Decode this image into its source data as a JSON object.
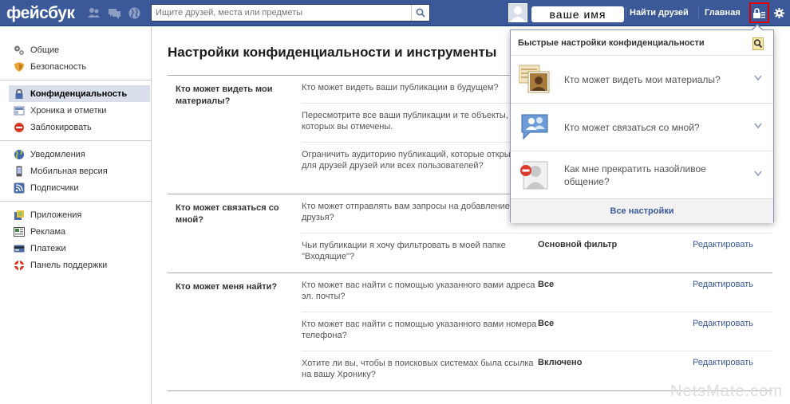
{
  "topbar": {
    "logo": "фейсбук",
    "search_placeholder": "Ищите друзей, места или предметы",
    "user_name": "ваше имя",
    "find_friends": "Найти друзей",
    "home": "Главная"
  },
  "sidebar": {
    "groups": [
      [
        {
          "label": "Общие",
          "icon": "gears-icon"
        },
        {
          "label": "Безопасность",
          "icon": "shield-icon"
        }
      ],
      [
        {
          "label": "Конфиденциальность",
          "icon": "lock-icon"
        },
        {
          "label": "Хроника и отметки",
          "icon": "timeline-icon"
        },
        {
          "label": "Заблокировать",
          "icon": "block-icon"
        }
      ],
      [
        {
          "label": "Уведомления",
          "icon": "globe-icon"
        },
        {
          "label": "Мобильная версия",
          "icon": "mobile-icon"
        },
        {
          "label": "Подписчики",
          "icon": "rss-icon"
        }
      ],
      [
        {
          "label": "Приложения",
          "icon": "apps-icon"
        },
        {
          "label": "Реклама",
          "icon": "ads-icon"
        },
        {
          "label": "Платежи",
          "icon": "payments-icon"
        },
        {
          "label": "Панель поддержки",
          "icon": "lifebuoy-icon"
        }
      ]
    ]
  },
  "main": {
    "title": "Настройки конфиденциальности и инструменты",
    "sections": [
      {
        "label": "Кто может видеть мои материалы?",
        "rows": [
          {
            "question": "Кто может видеть ваши публикации в будущем?",
            "value": "",
            "edit": ""
          },
          {
            "question": "Пересмотрите все ваши публикации и те объекты, которых вы отмечены.",
            "value": "",
            "edit": ""
          },
          {
            "question": "Ограничить аудиторию публикаций, которые открыты для друзей друзей или всех пользователей?",
            "value": "",
            "edit": ""
          }
        ]
      },
      {
        "label": "Кто может связаться со мной?",
        "rows": [
          {
            "question": "Кто может отправлять вам запросы на добавление в друзья?",
            "value": "",
            "edit": ""
          },
          {
            "question": "Чьи публикации я хочу фильтровать в моей папке \"Входящие\"?",
            "value": "Основной фильтр",
            "edit": "Редактировать"
          }
        ]
      },
      {
        "label": "Кто может меня найти?",
        "rows": [
          {
            "question": "Кто может вас найти с помощью указанного вами адреса эл. почты?",
            "value": "Все",
            "edit": "Редактировать"
          },
          {
            "question": "Кто может вас найти с помощью указанного вами номера телефона?",
            "value": "Все",
            "edit": "Редактировать"
          },
          {
            "question": "Хотите ли вы, чтобы в поисковых системах была ссылка на вашу Хронику?",
            "value": "Включено",
            "edit": "Редактировать"
          }
        ]
      }
    ]
  },
  "dropdown": {
    "title": "Быстрые настройки конфиденциальности",
    "items": [
      {
        "label": "Кто может видеть мои материалы?",
        "icon": "profile-card-icon"
      },
      {
        "label": "Кто может связаться со мной?",
        "icon": "contacts-speech-icon"
      },
      {
        "label": "Как мне прекратить назойливое общение?",
        "icon": "block-user-icon"
      }
    ],
    "footer": "Все настройки"
  },
  "watermark": "NetsMate.com",
  "colors": {
    "brand": "#3b5998",
    "highlight": "#e00000",
    "active_bg": "#d8dfea"
  }
}
